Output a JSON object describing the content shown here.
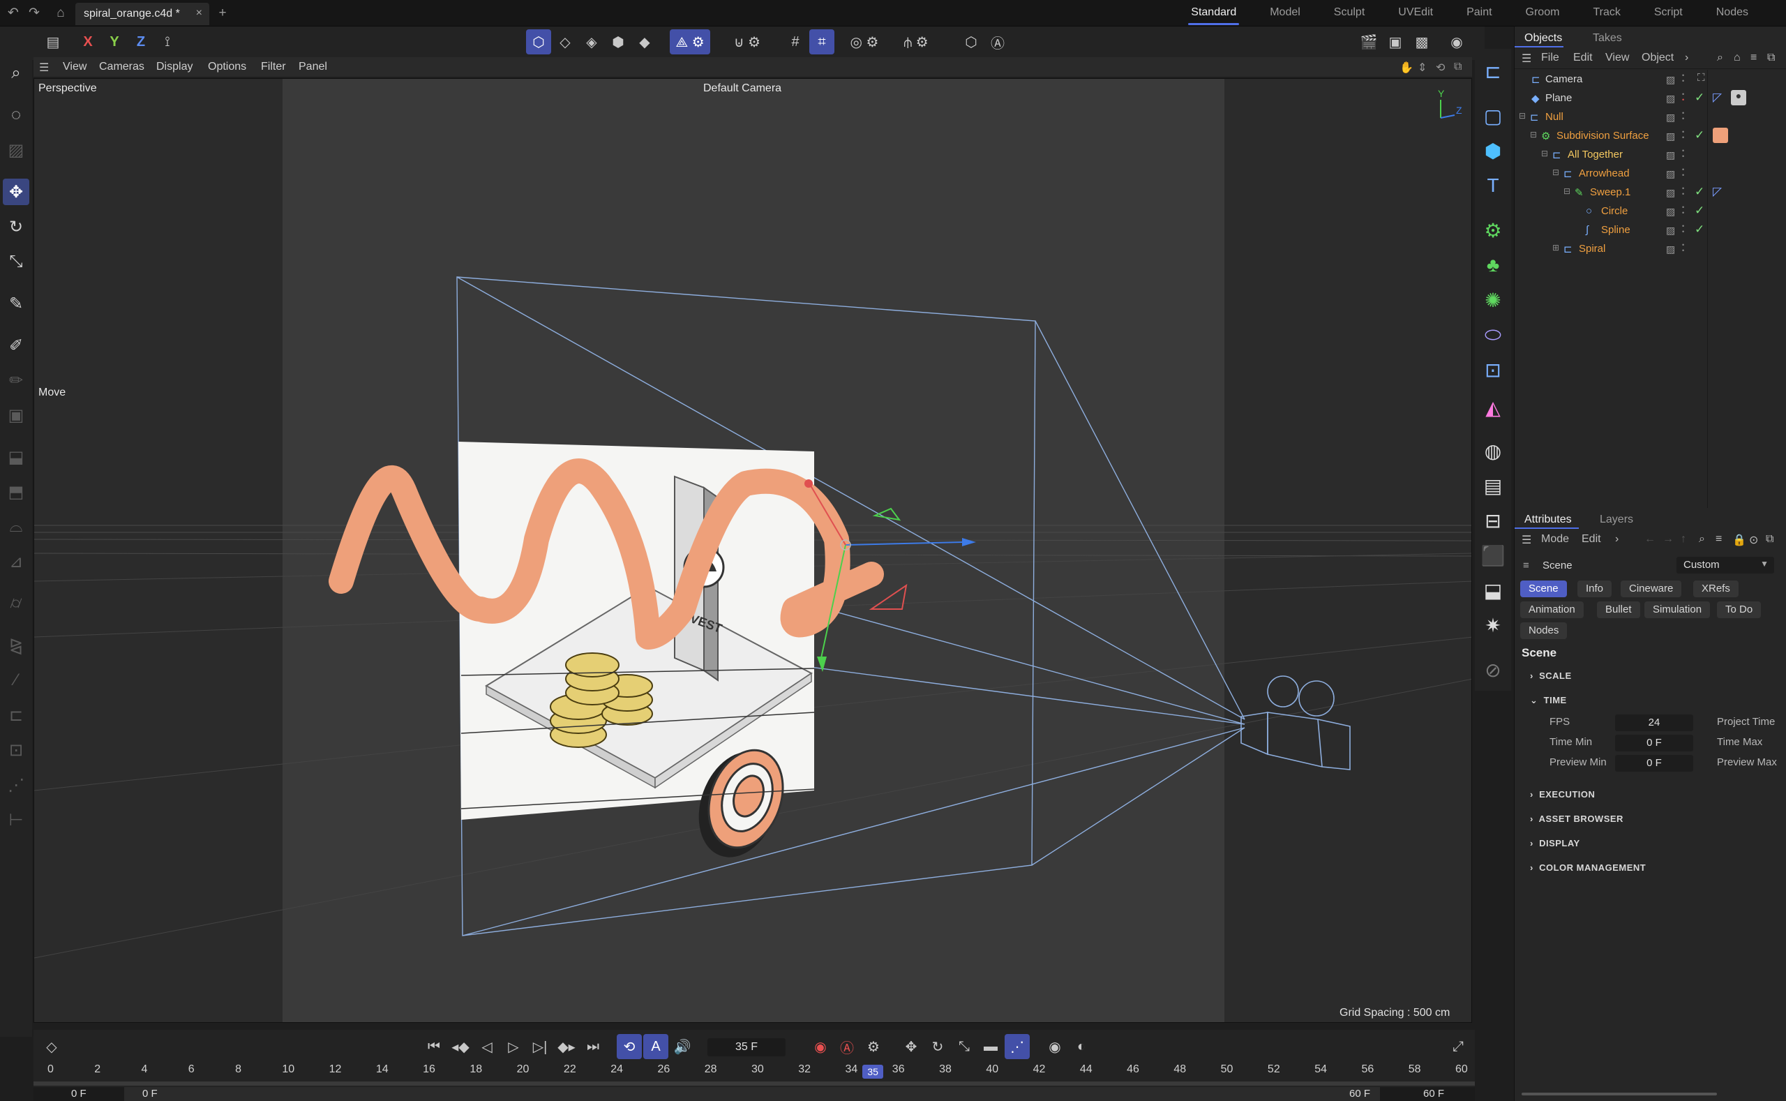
{
  "titlebar": {
    "doc_name": "spiral_orange.c4d *",
    "close": "×",
    "add": "+",
    "layouts": [
      "Standard",
      "Model",
      "Sculpt",
      "UVEdit",
      "Paint",
      "Groom",
      "Track",
      "Script",
      "Nodes"
    ],
    "active_layout": "Standard"
  },
  "toolbar": {
    "axis_x": "X",
    "axis_y": "Y",
    "axis_z": "Z"
  },
  "viewport_menu": [
    "View",
    "Cameras",
    "Display",
    "Options",
    "Filter",
    "Panel"
  ],
  "viewport": {
    "view_name": "Perspective",
    "camera_name": "Default Camera",
    "tool_name": "Move",
    "grid_spacing": "Grid Spacing : 500 cm",
    "invest_label": "INVEST",
    "axis_y_label": "Y",
    "axis_z_label": "Z"
  },
  "objects_panel": {
    "tabs": [
      "Objects",
      "Takes"
    ],
    "menu": [
      "File",
      "Edit",
      "View",
      "Object",
      "›"
    ],
    "rows": [
      {
        "name": "Camera",
        "color": "#d8d8d8"
      },
      {
        "name": "Plane",
        "color": "#d8d8d8"
      },
      {
        "name": "Null",
        "color": "#f0a040"
      },
      {
        "name": "Subdivision Surface",
        "color": "#f0a040"
      },
      {
        "name": "All Together",
        "color": "#f4c860"
      },
      {
        "name": "Arrowhead",
        "color": "#f0a040"
      },
      {
        "name": "Sweep.1",
        "color": "#f0a040"
      },
      {
        "name": "Circle",
        "color": "#f0a040"
      },
      {
        "name": "Spline",
        "color": "#f0a040"
      },
      {
        "name": "Spiral",
        "color": "#f0a040"
      }
    ]
  },
  "attributes_panel": {
    "tabs": [
      "Attributes",
      "Layers"
    ],
    "menu": [
      "Mode",
      "Edit",
      "›"
    ],
    "context": "Scene",
    "preset": "Custom",
    "chips_row1": [
      "Scene",
      "Info",
      "Cineware",
      "XRefs"
    ],
    "chips_row2": [
      "Animation",
      "Bullet",
      "Simulation",
      "To Do"
    ],
    "chips_row3": [
      "Nodes"
    ],
    "section_title": "Scene",
    "groups": [
      "SCALE",
      "TIME",
      "EXECUTION",
      "ASSET BROWSER",
      "DISPLAY",
      "COLOR MANAGEMENT"
    ],
    "fields": [
      {
        "label": "FPS",
        "value": "24",
        "right_label": "Project Time"
      },
      {
        "label": "Time Min",
        "value": "0 F",
        "right_label": "Time Max"
      },
      {
        "label": "Preview Min",
        "value": "0 F",
        "right_label": "Preview Max"
      }
    ]
  },
  "timeline": {
    "current_frame": "35 F",
    "ticks": [
      "0",
      "2",
      "4",
      "6",
      "8",
      "10",
      "12",
      "14",
      "16",
      "18",
      "20",
      "22",
      "24",
      "26",
      "28",
      "30",
      "32",
      "34",
      "36",
      "38",
      "40",
      "42",
      "44",
      "46",
      "48",
      "50",
      "52",
      "54",
      "56",
      "58",
      "60"
    ],
    "playhead_label": "35",
    "playhead_value": 35,
    "start": "0 F",
    "preview_start": "0 F",
    "preview_end": "60 F",
    "end": "60 F"
  },
  "colors": {
    "accent": "#4f5ec4",
    "spiral": "#eea07a",
    "camera_wire": "#8eaede"
  }
}
